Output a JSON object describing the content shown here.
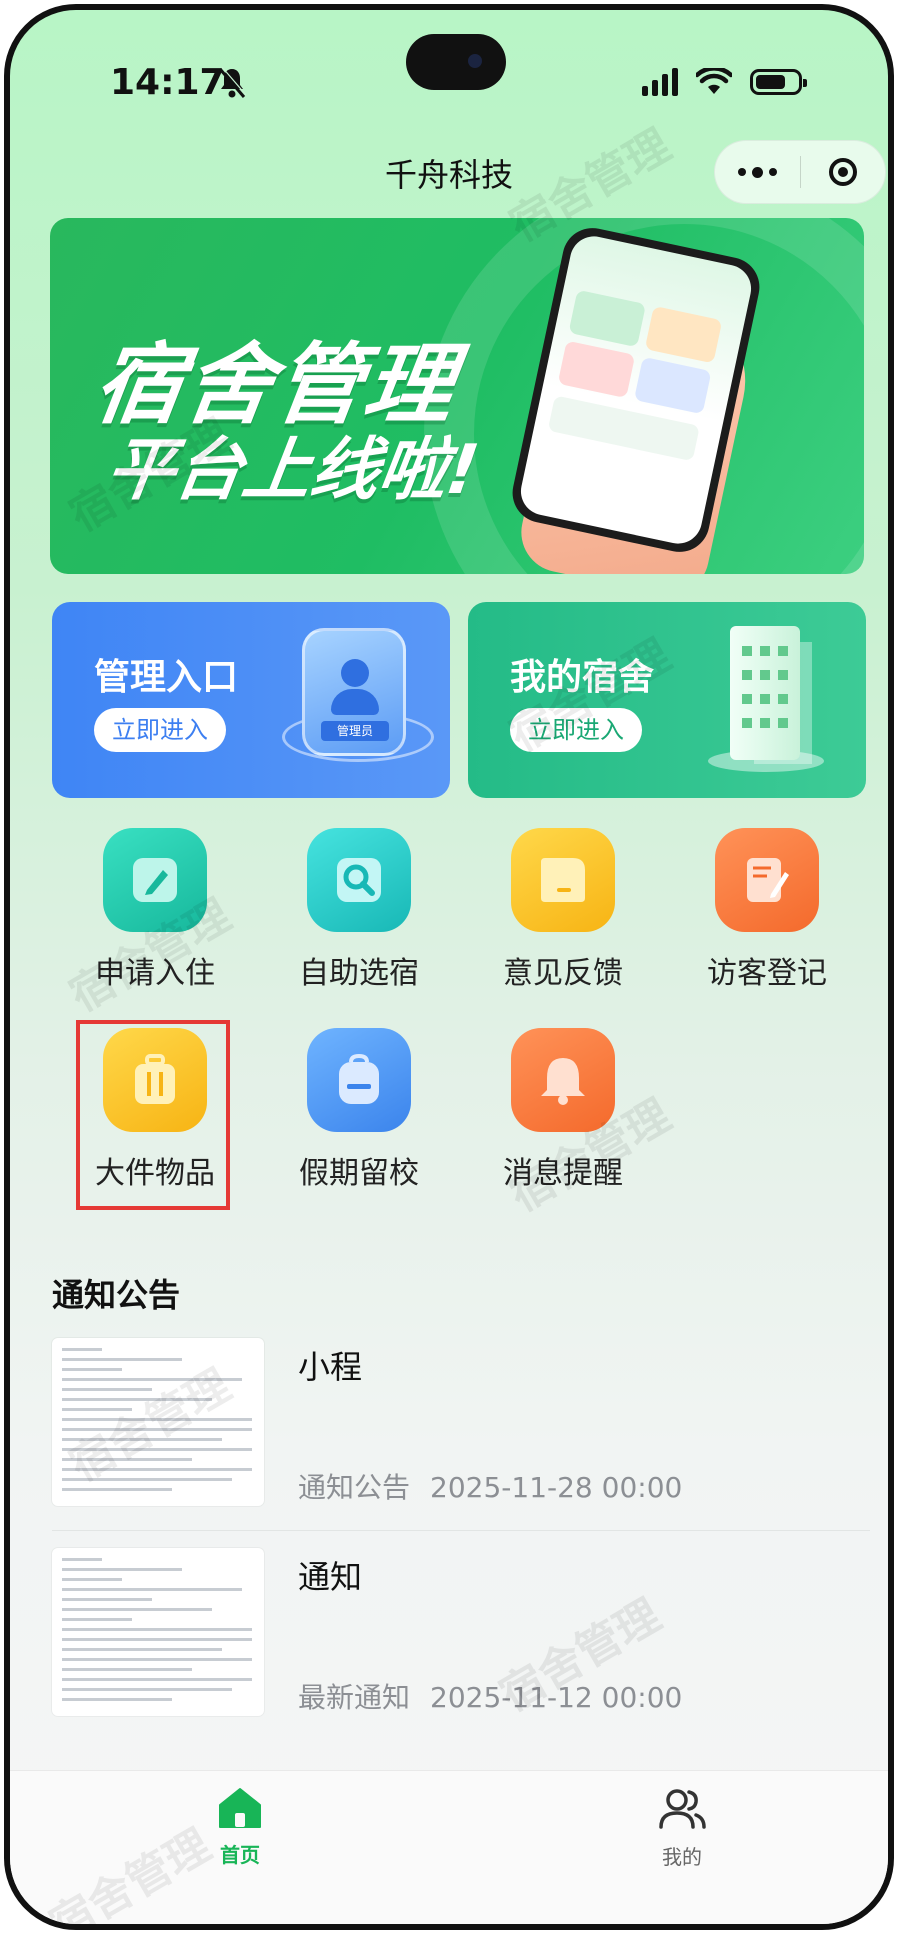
{
  "status_bar": {
    "time": "14:17",
    "signal_icon": "cellular-signal-icon",
    "wifi_icon": "wifi-icon",
    "battery_icon": "battery-icon",
    "mute_icon": "bell-slash-icon"
  },
  "header": {
    "title": "千舟科技",
    "more_icon": "more-dots-icon",
    "close_icon": "target-icon"
  },
  "banner": {
    "line1": "宿舍管理",
    "line2": "平台上线啦!"
  },
  "entries": [
    {
      "title": "管理入口",
      "button": "立即进入",
      "badge_text": "管理员"
    },
    {
      "title": "我的宿舍",
      "button": "立即进入"
    }
  ],
  "grid": [
    {
      "label": "申请入住",
      "icon": "pencil-edit-icon"
    },
    {
      "label": "自助选宿",
      "icon": "search-icon"
    },
    {
      "label": "意见反馈",
      "icon": "message-box-icon"
    },
    {
      "label": "访客登记",
      "icon": "notebook-pen-icon"
    },
    {
      "label": "大件物品",
      "icon": "suitcase-icon"
    },
    {
      "label": "假期留校",
      "icon": "backpack-icon"
    },
    {
      "label": "消息提醒",
      "icon": "bell-icon"
    }
  ],
  "notices": {
    "section_title": "通知公告",
    "items": [
      {
        "title": "小程",
        "category": "通知公告",
        "date": "2025-11-28 00:00"
      },
      {
        "title": "通知",
        "category": "最新通知",
        "date": "2025-11-12 00:00"
      }
    ]
  },
  "tabbar": {
    "items": [
      {
        "label": "首页",
        "icon": "home-icon",
        "active": true
      },
      {
        "label": "我的",
        "icon": "users-icon",
        "active": false
      }
    ]
  },
  "watermark": "宿舍管理",
  "colors": {
    "accent": "#18b557",
    "admin_card": "#3f85f5",
    "dorm_card": "#24bb87",
    "highlight_box": "#e53935"
  }
}
